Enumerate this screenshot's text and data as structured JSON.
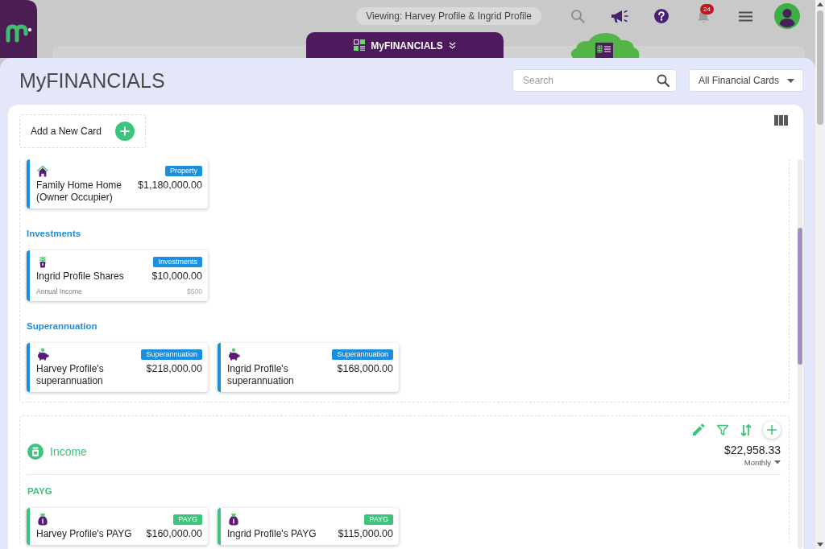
{
  "header": {
    "viewing": "Viewing: Harvey Profile & Ingrid Profile",
    "notification_count": "24"
  },
  "nav_tab": {
    "label": "MyFINANCIALS"
  },
  "panel": {
    "title": "MyFINANCIALS",
    "search": {
      "placeholder": "Search"
    },
    "filter": {
      "value": "All Financial Cards"
    },
    "add_card": {
      "label": "Add a New Card"
    }
  },
  "sections": [
    {
      "kind": "assets",
      "groups": [
        {
          "cards": [
            {
              "kind": "property",
              "badge": "Property",
              "name": "Family Home Home (Owner Occupier)",
              "amount": "$1,180,000.00"
            }
          ]
        },
        {
          "heading": "Investments",
          "cards": [
            {
              "kind": "shares",
              "badge": "Investments",
              "name": "Ingrid Profile Shares",
              "amount": "$10,000.00",
              "note_label": "Annual Income",
              "note_value": "$500"
            }
          ]
        },
        {
          "heading": "Superannuation",
          "cards": [
            {
              "kind": "super",
              "badge": "Superannuation",
              "name": "Harvey Profile's superannuation",
              "amount": "$218,000.00"
            },
            {
              "kind": "super",
              "badge": "Superannuation",
              "name": "Ingrid Profile's superannuation",
              "amount": "$168,000.00"
            }
          ]
        }
      ]
    },
    {
      "kind": "income",
      "title": "Income",
      "total": "$22,958.33",
      "period": "Monthly",
      "groups": [
        {
          "heading": "PAYG",
          "cards": [
            {
              "kind": "payg",
              "badge": "PAYG",
              "name": "Harvey Profile's PAYG",
              "amount": "$160,000.00"
            },
            {
              "kind": "payg",
              "badge": "PAYG",
              "name": "Ingrid Profile's PAYG",
              "amount": "$115,000.00"
            }
          ]
        }
      ]
    }
  ]
}
